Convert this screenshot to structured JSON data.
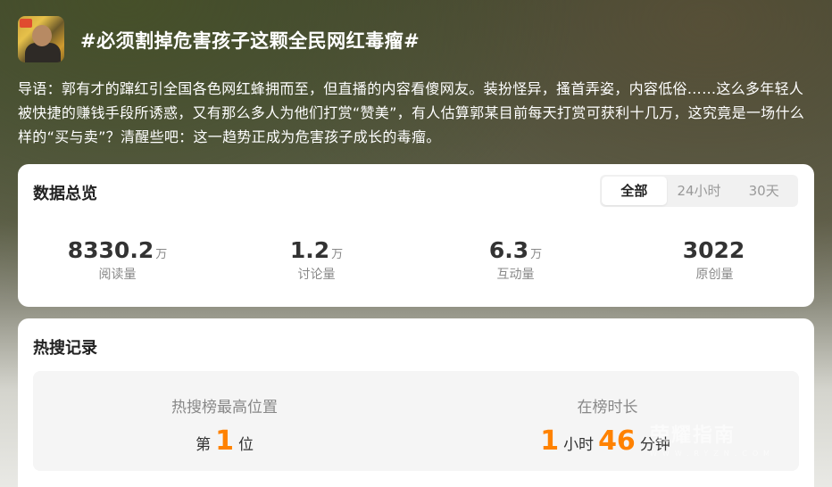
{
  "topic": {
    "title": "#必须割掉危害孩子这颗全民网红毒瘤#",
    "intro": "导语：郭有才的蹿红引全国各色网红蜂拥而至，但直播的内容看傻网友。装扮怪异，搔首弄姿，内容低俗……这么多年轻人被快捷的赚钱手段所诱惑，又有那么多人为他们打赏“赞美”，有人估算郭某目前每天打赏可获利十几万，这究竟是一场什么样的“买与卖”？清醒些吧：这一趋势正成为危害孩子成长的毒瘤。"
  },
  "overview": {
    "title": "数据总览",
    "tabs": [
      {
        "label": "全部",
        "active": true
      },
      {
        "label": "24小时",
        "active": false
      },
      {
        "label": "30天",
        "active": false
      }
    ],
    "stats": [
      {
        "value": "8330.2",
        "unit": "万",
        "label": "阅读量"
      },
      {
        "value": "1.2",
        "unit": "万",
        "label": "讨论量"
      },
      {
        "value": "6.3",
        "unit": "万",
        "label": "互动量"
      },
      {
        "value": "3022",
        "unit": "",
        "label": "原创量"
      }
    ]
  },
  "hot_search": {
    "title": "热搜记录",
    "peak": {
      "label": "热搜榜最高位置",
      "prefix": "第",
      "value": "1",
      "suffix": "位"
    },
    "duration": {
      "label": "在榜时长",
      "hours": "1",
      "hours_unit": "小时",
      "minutes": "46",
      "minutes_unit": "分钟"
    }
  },
  "watermark": {
    "text": "荣耀指南",
    "sub": "WWW.RYZN.COM"
  },
  "colors": {
    "accent": "#ff8200",
    "card_bg": "#ffffff",
    "panel_bg": "#f5f5f5"
  }
}
